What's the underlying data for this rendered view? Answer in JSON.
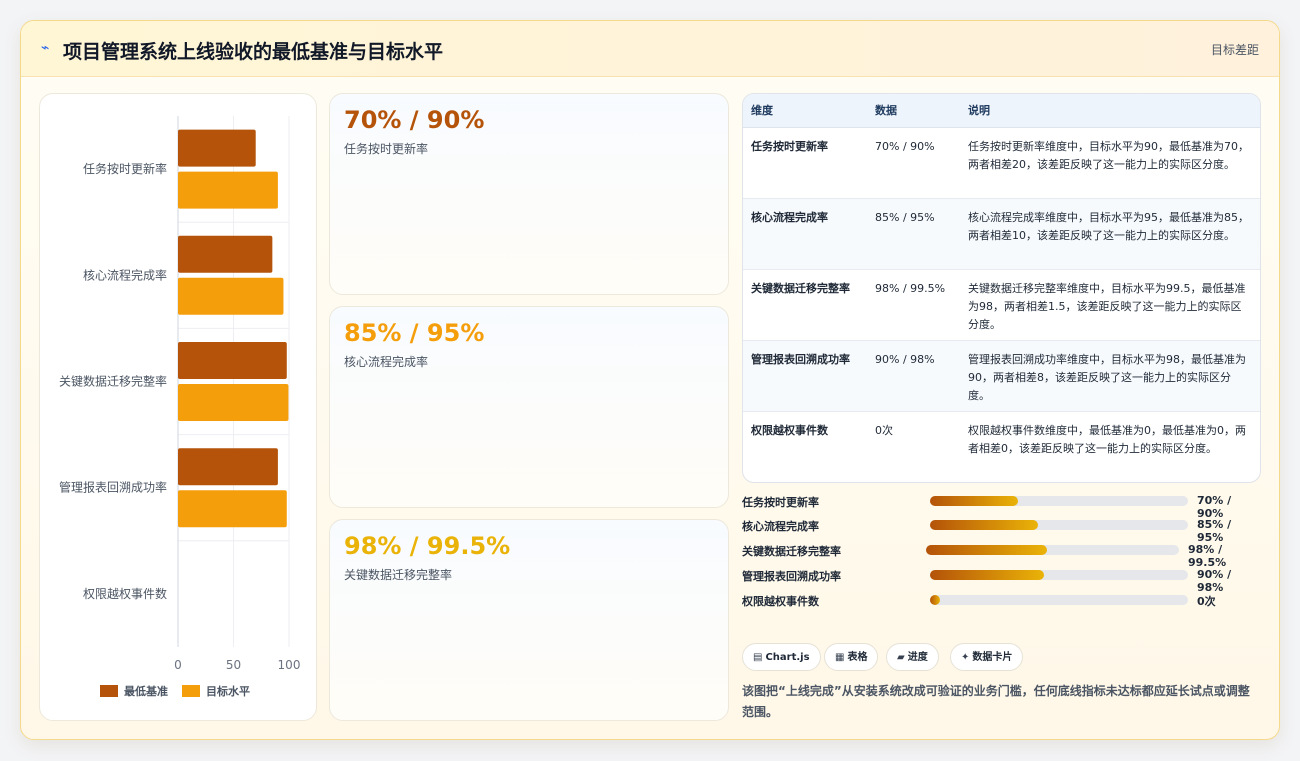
{
  "header": {
    "icon": "lightning-icon",
    "title": "项目管理系统上线验收的最低基准与目标水平",
    "right_label": "目标差距"
  },
  "chart_data": {
    "type": "bar",
    "orientation": "horizontal",
    "categories": [
      "任务按时更新率",
      "核心流程完成率",
      "关键数据迁移完整率",
      "管理报表回溯成功率",
      "权限越权事件数"
    ],
    "series": [
      {
        "name": "最低基准",
        "values": [
          70,
          85,
          98,
          90,
          0
        ],
        "color": "#b45309"
      },
      {
        "name": "目标水平",
        "values": [
          90,
          95,
          99.5,
          98,
          0
        ],
        "color": "#f59e0b"
      }
    ],
    "xlim": [
      0,
      100
    ],
    "x_ticks": [
      "0",
      "50",
      "100"
    ],
    "legend_position": "bottom",
    "grid": true
  },
  "kpis": [
    {
      "value": "70% / 90%",
      "label": "任务按时更新率",
      "color": "#b45309"
    },
    {
      "value": "85% / 95%",
      "label": "核心流程完成率",
      "color": "#f59e0b"
    },
    {
      "value": "98% / 99.5%",
      "label": "关键数据迁移完整率",
      "color": "#eab308"
    }
  ],
  "table": {
    "headers": [
      "维度",
      "数据",
      "说明"
    ],
    "rows": [
      {
        "name": "任务按时更新率",
        "data": "70% / 90%",
        "desc": "任务按时更新率维度中，目标水平为90，最低基准为70，两者相差20，该差距反映了这一能力上的实际区分度。"
      },
      {
        "name": "核心流程完成率",
        "data": "85% / 95%",
        "desc": "核心流程完成率维度中，目标水平为95，最低基准为85，两者相差10，该差距反映了这一能力上的实际区分度。"
      },
      {
        "name": "关键数据迁移完整率",
        "data": "98% / 99.5%",
        "desc": "关键数据迁移完整率维度中，目标水平为99.5，最低基准为98，两者相差1.5，该差距反映了这一能力上的实际区分度。"
      },
      {
        "name": "管理报表回溯成功率",
        "data": "90% / 98%",
        "desc": "管理报表回溯成功率维度中，目标水平为98，最低基准为90，两者相差8，该差距反映了这一能力上的实际区分度。"
      },
      {
        "name": "权限越权事件数",
        "data": "0次",
        "desc": "权限越权事件数维度中，最低基准为0，最低基准为0，两者相差0，该差距反映了这一能力上的实际区分度。"
      }
    ]
  },
  "progress": [
    {
      "label": "任务按时更新率",
      "value": "70% / 90%",
      "fraction": 0.34
    },
    {
      "label": "核心流程完成率",
      "value": "85% / 95%",
      "fraction": 0.42
    },
    {
      "label": "关键数据迁移完整率",
      "value": "98% / 99.5%",
      "fraction": 0.48
    },
    {
      "label": "管理报表回溯成功率",
      "value": "90% / 98%",
      "fraction": 0.44
    },
    {
      "label": "权限越权事件数",
      "value": "0次",
      "fraction": 0.04
    }
  ],
  "tags": [
    {
      "icon": "chart-icon",
      "glyph": "▤",
      "label": "Chart.js"
    },
    {
      "icon": "table-icon",
      "glyph": "▦",
      "label": "表格"
    },
    {
      "icon": "progress-icon",
      "glyph": "▰",
      "label": "进度"
    },
    {
      "icon": "sparkle-icon",
      "glyph": "✦",
      "label": "数据卡片"
    }
  ],
  "footnote": "该图把“上线完成”从安装系统改成可验证的业务门槛，任何底线指标未达标都应延长试点或调整范围。"
}
